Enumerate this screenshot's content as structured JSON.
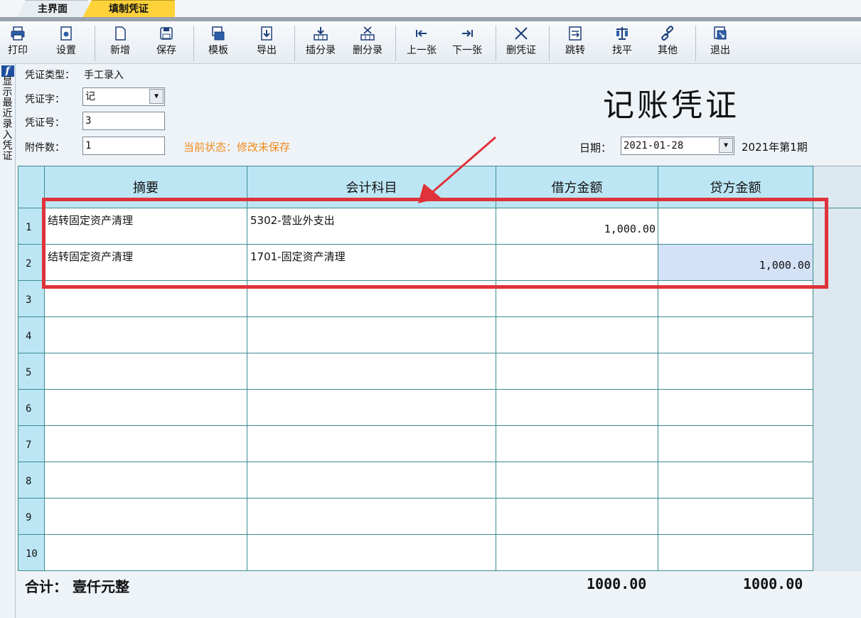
{
  "tabs": [
    {
      "label": "主界面"
    },
    {
      "label": "填制凭证"
    }
  ],
  "toolbar": {
    "buttons": [
      {
        "label": "打印",
        "icon": "print-icon"
      },
      {
        "label": "设置",
        "icon": "settings-icon"
      },
      {
        "label": "新增",
        "icon": "new-doc-icon"
      },
      {
        "label": "保存",
        "icon": "save-icon"
      },
      {
        "label": "模板",
        "icon": "template-icon"
      },
      {
        "label": "导出",
        "icon": "export-icon"
      },
      {
        "label": "插分录",
        "icon": "insert-entry-icon"
      },
      {
        "label": "删分录",
        "icon": "delete-entry-icon"
      },
      {
        "label": "上一张",
        "icon": "prev-icon"
      },
      {
        "label": "下一张",
        "icon": "next-icon"
      },
      {
        "label": "删凭证",
        "icon": "delete-voucher-icon"
      },
      {
        "label": "跳转",
        "icon": "jump-icon"
      },
      {
        "label": "找平",
        "icon": "balance-icon"
      },
      {
        "label": "其他",
        "icon": "other-icon"
      },
      {
        "label": "退出",
        "icon": "exit-icon"
      }
    ]
  },
  "side_panel": {
    "badge": "f",
    "text": "显示最近录入凭证"
  },
  "voucher": {
    "type_label": "凭证类型：",
    "type_value": "手工录入",
    "word_label": "凭证字：",
    "word_value": "记",
    "number_label": "凭证号：",
    "number_value": "3",
    "attach_label": "附件数：",
    "attach_value": "1",
    "status_label": "当前状态：",
    "status_value": "修改未保存",
    "title": "记账凭证",
    "date_label": "日期：",
    "date_value": "2021-01-28",
    "period": "2021年第1期"
  },
  "grid": {
    "headers": [
      "摘要",
      "会计科目",
      "借方金额",
      "贷方金额"
    ],
    "rows": [
      {
        "no": "1",
        "summary": "结转固定资产清理",
        "account": "5302-营业外支出",
        "debit": "1,000.00",
        "credit": ""
      },
      {
        "no": "2",
        "summary": "结转固定资产清理",
        "account": "1701-固定资产清理",
        "debit": "",
        "credit": "1,000.00"
      },
      {
        "no": "3",
        "summary": "",
        "account": "",
        "debit": "",
        "credit": ""
      },
      {
        "no": "4",
        "summary": "",
        "account": "",
        "debit": "",
        "credit": ""
      },
      {
        "no": "5",
        "summary": "",
        "account": "",
        "debit": "",
        "credit": ""
      },
      {
        "no": "6",
        "summary": "",
        "account": "",
        "debit": "",
        "credit": ""
      },
      {
        "no": "7",
        "summary": "",
        "account": "",
        "debit": "",
        "credit": ""
      },
      {
        "no": "8",
        "summary": "",
        "account": "",
        "debit": "",
        "credit": ""
      },
      {
        "no": "9",
        "summary": "",
        "account": "",
        "debit": "",
        "credit": ""
      },
      {
        "no": "10",
        "summary": "",
        "account": "",
        "debit": "",
        "credit": ""
      }
    ]
  },
  "totals": {
    "label": "合计：  壹仟元整",
    "debit": "1000.00",
    "credit": "1000.00"
  },
  "colors": {
    "header_bg": "#bde6f5",
    "selected_cell": "#d3e2f6",
    "highlight_box": "#e0323a",
    "arrow": "#e0323a",
    "status_text": "#f08a1a",
    "active_tab": "#ffd23a"
  }
}
